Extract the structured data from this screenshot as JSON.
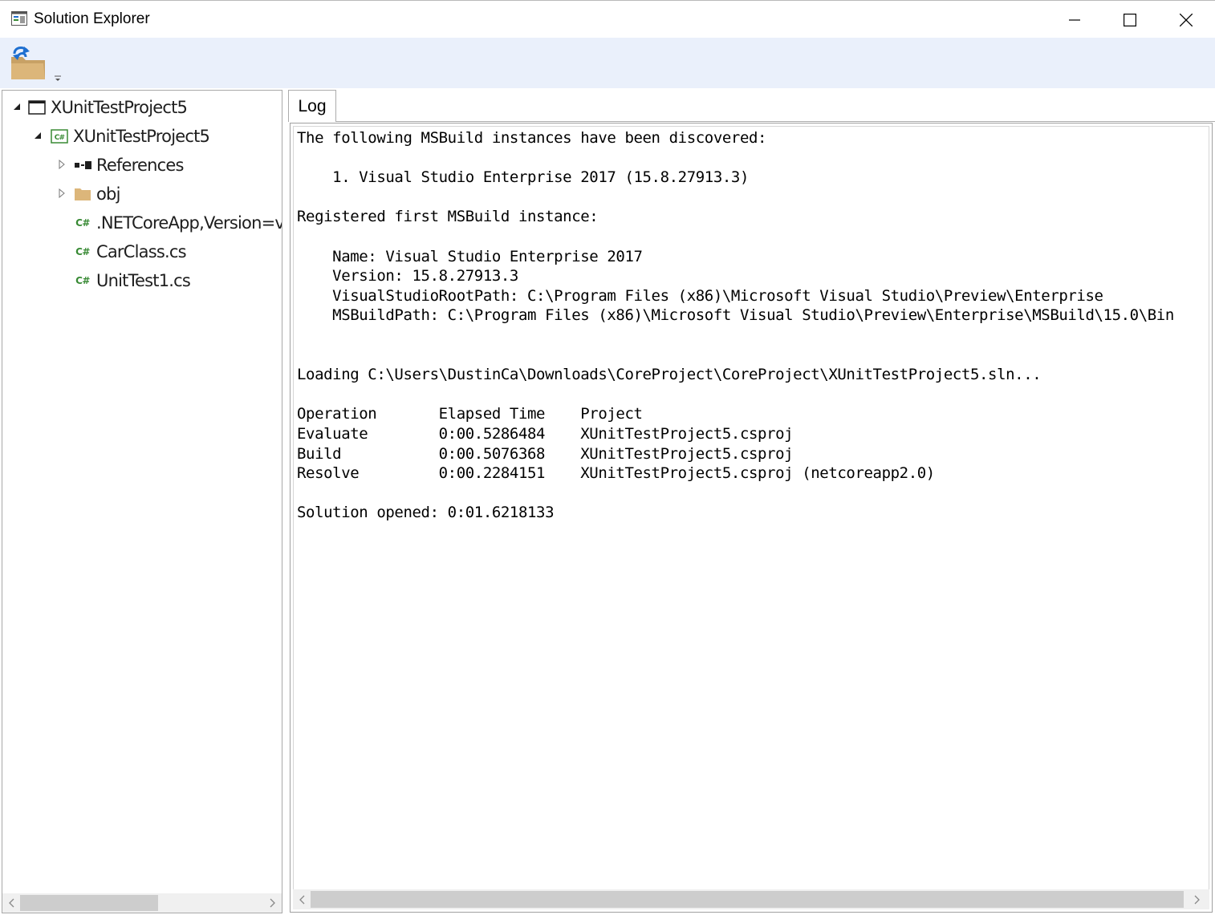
{
  "window": {
    "title": "Solution Explorer",
    "icon": "solution-explorer-icon",
    "buttons": [
      "minimize-icon",
      "maximize-icon",
      "close-icon"
    ]
  },
  "toolbar": {
    "open_button_icon": "open-folder-icon",
    "dropdown_icon": "chevron-down-icon"
  },
  "tree": {
    "items": [
      {
        "label": "XUnitTestProject5",
        "icon": "solution-icon",
        "expander": "expanded"
      },
      {
        "label": "XUnitTestProject5",
        "icon": "csharp-project-icon",
        "expander": "expanded"
      },
      {
        "label": "References",
        "icon": "references-icon",
        "expander": "collapsed"
      },
      {
        "label": "obj",
        "icon": "folder-icon",
        "expander": "collapsed"
      },
      {
        "label": ".NETCoreApp,Version=v",
        "icon": "csharp-file-icon",
        "expander": "none"
      },
      {
        "label": "CarClass.cs",
        "icon": "csharp-file-icon",
        "expander": "none"
      },
      {
        "label": "UnitTest1.cs",
        "icon": "csharp-file-icon",
        "expander": "none"
      }
    ],
    "csharp_glyph": "C#"
  },
  "log": {
    "tab_label": "Log",
    "lines": [
      "The following MSBuild instances have been discovered:",
      "",
      "    1. Visual Studio Enterprise 2017 (15.8.27913.3)",
      "",
      "Registered first MSBuild instance:",
      "",
      "    Name: Visual Studio Enterprise 2017",
      "    Version: 15.8.27913.3",
      "    VisualStudioRootPath: C:\\Program Files (x86)\\Microsoft Visual Studio\\Preview\\Enterprise",
      "    MSBuildPath: C:\\Program Files (x86)\\Microsoft Visual Studio\\Preview\\Enterprise\\MSBuild\\15.0\\Bin",
      "",
      "",
      "Loading C:\\Users\\DustinCa\\Downloads\\CoreProject\\CoreProject\\XUnitTestProject5.sln...",
      "",
      "Operation       Elapsed Time    Project",
      "Evaluate        0:00.5286484    XUnitTestProject5.csproj",
      "Build           0:00.5076368    XUnitTestProject5.csproj",
      "Resolve         0:00.2284151    XUnitTestProject5.csproj (netcoreapp2.0)",
      "",
      "Solution opened: 0:01.6218133"
    ]
  },
  "colors": {
    "toolbar_bg": "#eaf0fb",
    "csharp_green": "#388a34",
    "folder_tan": "#dcb67a",
    "arrow_blue": "#1e6fd0"
  }
}
